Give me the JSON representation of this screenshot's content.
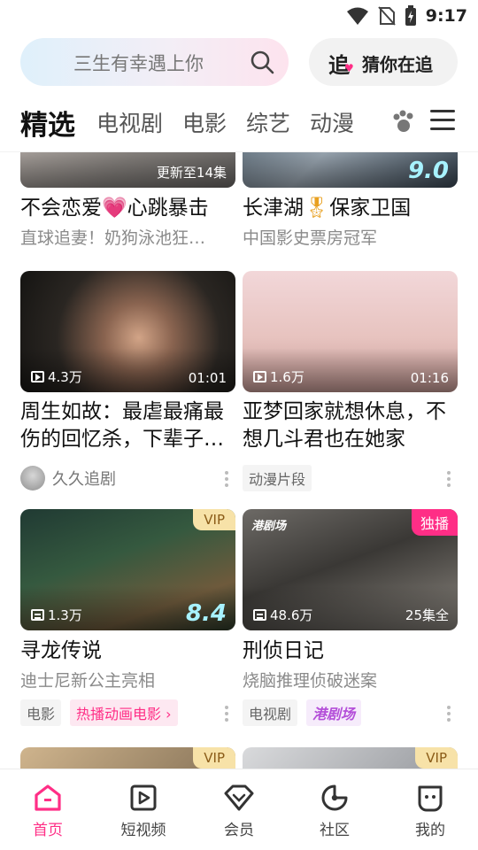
{
  "status": {
    "time": "9:17"
  },
  "search": {
    "text": "三生有幸遇上你"
  },
  "chase": {
    "icon_text": "追",
    "label": "猜你在追"
  },
  "tabs": [
    {
      "label": "精选",
      "active": true
    },
    {
      "label": "电视剧"
    },
    {
      "label": "电影"
    },
    {
      "label": "综艺"
    },
    {
      "label": "动漫"
    }
  ],
  "cards": [
    {
      "overlay_right": "更新至14集",
      "title_pre": "不会恋爱",
      "title_post": "心跳暴击",
      "subtitle": "直球追妻！奶狗泳池狂…"
    },
    {
      "overlay_score": "9.0",
      "title_pre": "长津湖",
      "title_post": "保家卫国",
      "subtitle": "中国影史票房冠军"
    },
    {
      "views": "4.3万",
      "duration": "01:01",
      "title": "周生如故：最虐最痛最伤的回忆杀，下辈子…",
      "uploader": "久久追剧"
    },
    {
      "views": "1.6万",
      "duration": "01:16",
      "title": "亚梦回家就想休息，不想几斗君也在她家",
      "tag": "动漫片段"
    },
    {
      "badge": "VIP",
      "views": "1.3万",
      "score": "8.4",
      "title": "寻龙传说",
      "subtitle": "迪士尼新公主亮相",
      "tags": [
        "电影",
        "热播动画电影 ›"
      ]
    },
    {
      "badge": "独播",
      "views": "48.6万",
      "episodes": "25集全",
      "thumb_logo": "港剧场",
      "title": "刑侦日记",
      "subtitle": "烧脑推理侦破迷案",
      "tags": [
        "电视剧",
        "港剧场"
      ]
    },
    {
      "badge": "VIP"
    },
    {
      "badge": "VIP"
    }
  ],
  "nav": [
    {
      "label": "首页",
      "active": true
    },
    {
      "label": "短视频"
    },
    {
      "label": "会员"
    },
    {
      "label": "社区"
    },
    {
      "label": "我的"
    }
  ],
  "colors": {
    "accent": "#ff2e86",
    "vip_bg": "#f7e2a8",
    "score": "#a7f2ff"
  }
}
